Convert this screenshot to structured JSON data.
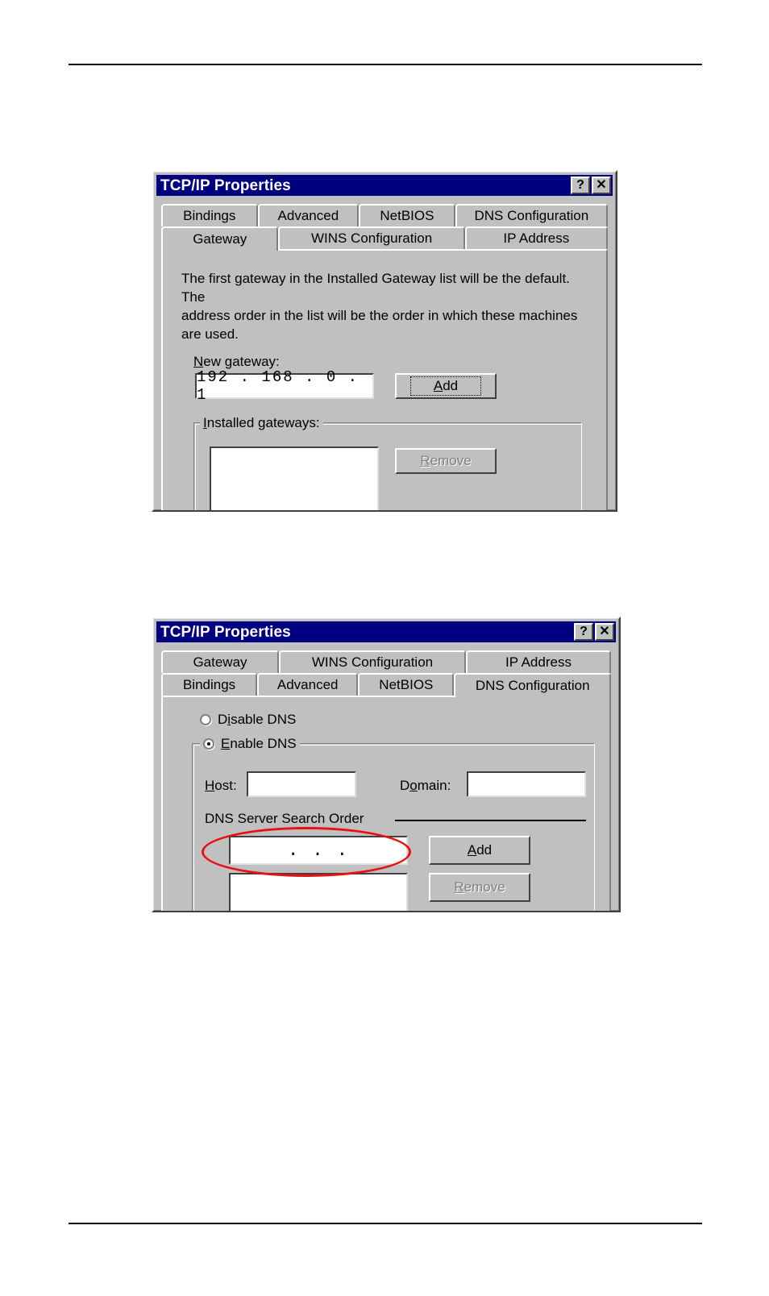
{
  "page": {
    "background": "#ffffff",
    "rule_color": "#000000"
  },
  "dialogs": [
    {
      "id": "gateway",
      "title": "TCP/IP Properties",
      "titlebar_color": "#000080",
      "titlebar_text_color": "#ffffff",
      "help_button": "?",
      "close_button": "✕",
      "tabs_row1": [
        "Bindings",
        "Advanced",
        "NetBIOS",
        "DNS Configuration"
      ],
      "tabs_row2": [
        "Gateway",
        "WINS Configuration",
        "IP Address"
      ],
      "active_tab": "Gateway",
      "description": "The first gateway in the Installed Gateway list will be the default. The\naddress order in the list will be the order in which these machines\nare used.",
      "new_gateway_label": "New gateway:",
      "new_gateway_label_accel": "N",
      "new_gateway_value": "192 . 168 .  0  .  1",
      "add_button": "Add",
      "add_button_accel": "A",
      "installed_gateways_label": "Installed gateways:",
      "installed_gateways_label_accel": "I",
      "installed_gateways_items": [],
      "remove_button": "Remove",
      "remove_button_accel": "R",
      "remove_button_enabled": false
    },
    {
      "id": "dns",
      "title": "TCP/IP Properties",
      "titlebar_color": "#000080",
      "titlebar_text_color": "#ffffff",
      "help_button": "?",
      "close_button": "✕",
      "tabs_row1": [
        "Gateway",
        "WINS Configuration",
        "IP Address"
      ],
      "tabs_row2": [
        "Bindings",
        "Advanced",
        "NetBIOS",
        "DNS Configuration"
      ],
      "active_tab": "DNS Configuration",
      "radio_disable_label": "Disable DNS",
      "radio_disable_accel": "i",
      "radio_disable_selected": false,
      "radio_enable_label": "Enable DNS",
      "radio_enable_accel": "E",
      "radio_enable_selected": true,
      "host_label": "Host:",
      "host_label_accel": "H",
      "host_value": "",
      "domain_label": "Domain:",
      "domain_label_accel": "o",
      "domain_value": "",
      "search_order_label": "DNS Server Search Order",
      "search_order_value": ".            .            .",
      "add_button": "Add",
      "add_button_accel": "A",
      "remove_button": "Remove",
      "remove_button_accel": "R",
      "remove_button_enabled": false,
      "search_list_items": []
    }
  ],
  "annotation": {
    "type": "ellipse",
    "color": "#e81010",
    "target": "dns-search-order-input"
  }
}
